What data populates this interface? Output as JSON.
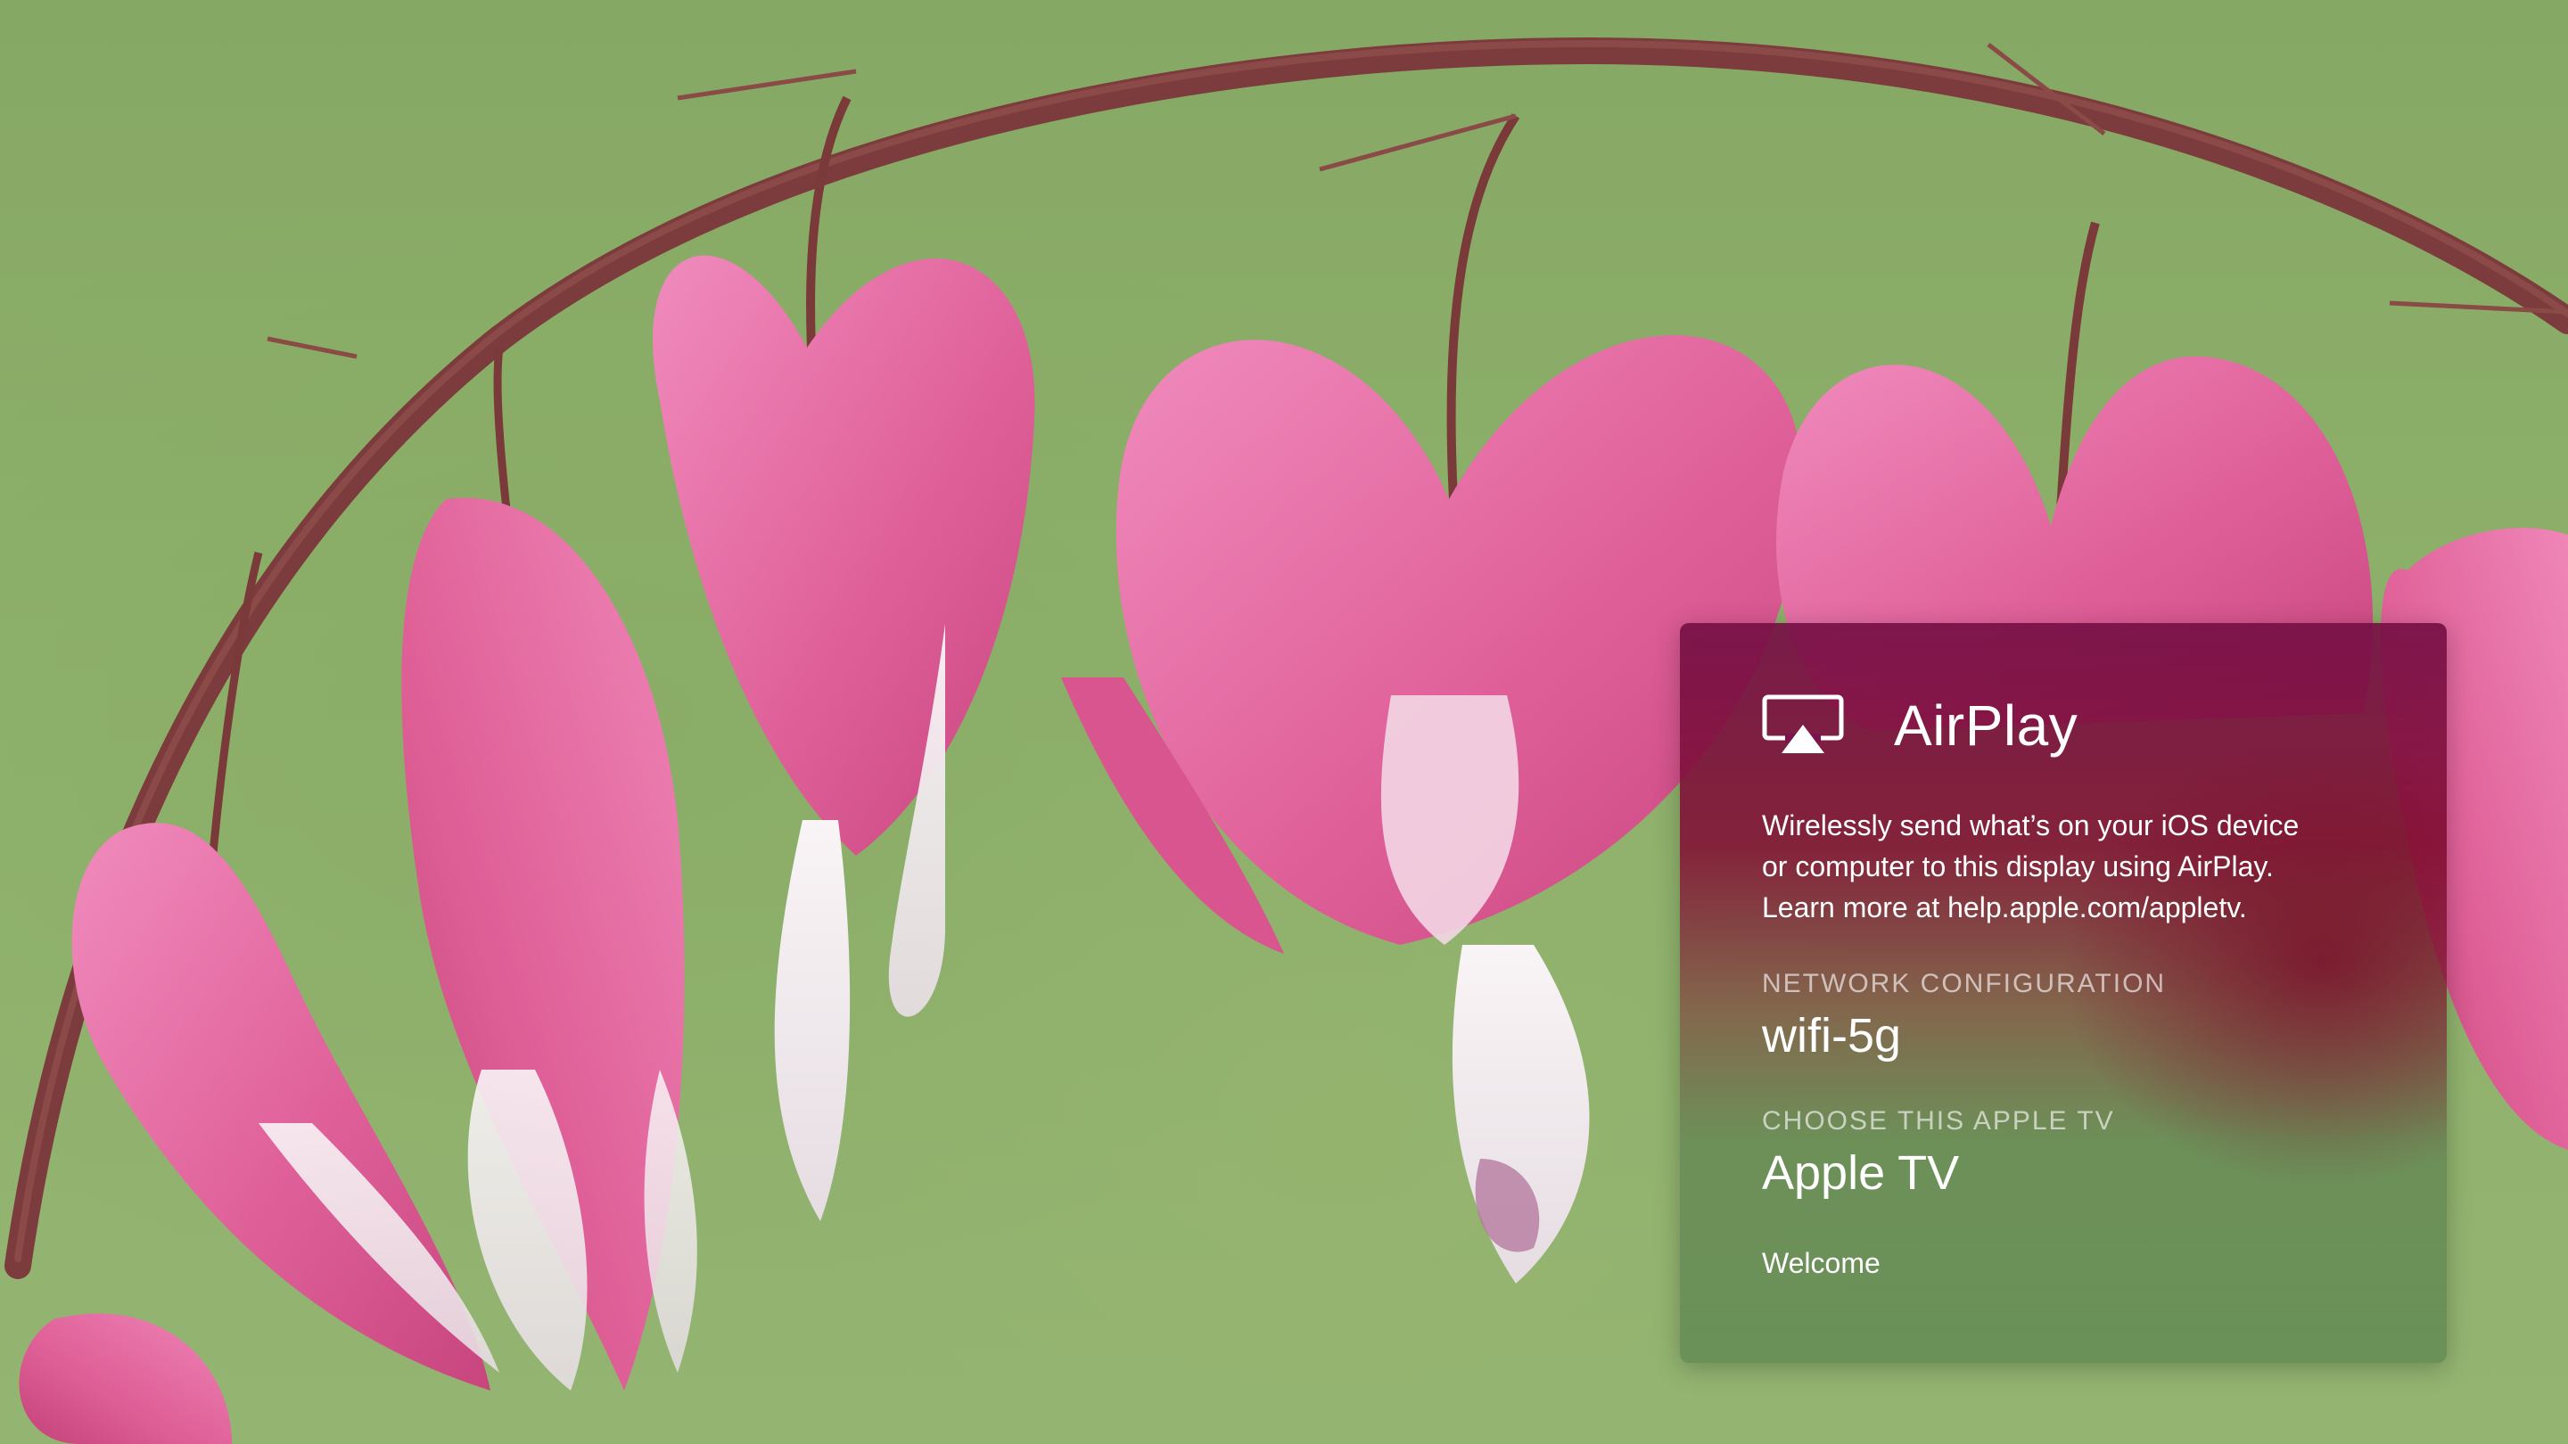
{
  "wallpaper": {
    "subject": "bleeding heart flowers",
    "colors": {
      "background": "#8fae6a",
      "stem": "#7a3a3a",
      "petal": "#e0619a",
      "petal_light": "#ee8cbb",
      "inner_white": "#f4eef0"
    }
  },
  "airplay_panel": {
    "icon": "airplay-icon",
    "title": "AirPlay",
    "description_lines": [
      "Wirelessly send what’s on your iOS device",
      "or computer to this display using AirPlay.",
      "Learn more at help.apple.com/appletv."
    ],
    "network": {
      "label": "NETWORK CONFIGURATION",
      "value": "wifi-5g"
    },
    "device": {
      "label": "CHOOSE THIS APPLE TV",
      "value": "Apple TV"
    },
    "footer": "Welcome",
    "colors": {
      "panel_top": "#76104a",
      "panel_bottom": "#648c55",
      "text": "#ffffff"
    }
  }
}
